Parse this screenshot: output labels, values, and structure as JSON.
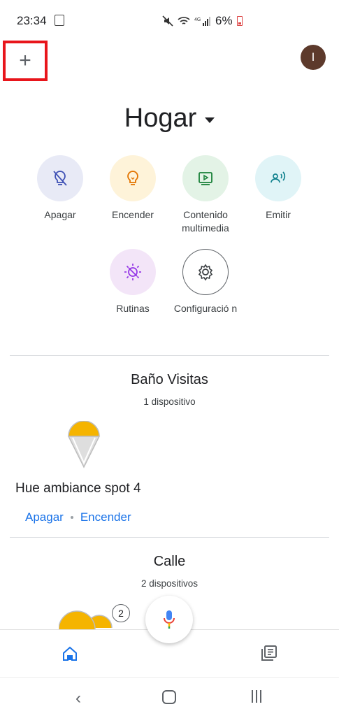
{
  "status_bar": {
    "time": "23:34",
    "battery": "6%"
  },
  "header": {
    "avatar_initial": "I",
    "home_name": "Hogar"
  },
  "actions": [
    {
      "label": "Apagar",
      "icon": "bulb-off-icon",
      "bg": "#e8eaf6"
    },
    {
      "label": "Encender",
      "icon": "bulb-icon",
      "bg": "#fef3d9"
    },
    {
      "label": "Contenido multimedia",
      "icon": "media-play-icon",
      "bg": "#e3f3e6"
    },
    {
      "label": "Emitir",
      "icon": "cast-icon",
      "bg": "#e0f4f7"
    },
    {
      "label": "Rutinas",
      "icon": "routines-sun-icon",
      "bg": "#f3e5f8"
    },
    {
      "label": "Configuració n",
      "icon": "gear-icon",
      "bg": "#ffffff"
    }
  ],
  "rooms": [
    {
      "name": "Baño Visitas",
      "device_count": "1 dispositivo",
      "device": {
        "name": "Hue ambiance spot 4",
        "off_label": "Apagar",
        "on_label": "Encender"
      }
    },
    {
      "name": "Calle",
      "device_count": "2 dispositivos",
      "badge": "2"
    }
  ],
  "colors": {
    "accent": "#1a73e8",
    "highlight_border": "#e8151b",
    "bulb_on": "#f5b400"
  }
}
